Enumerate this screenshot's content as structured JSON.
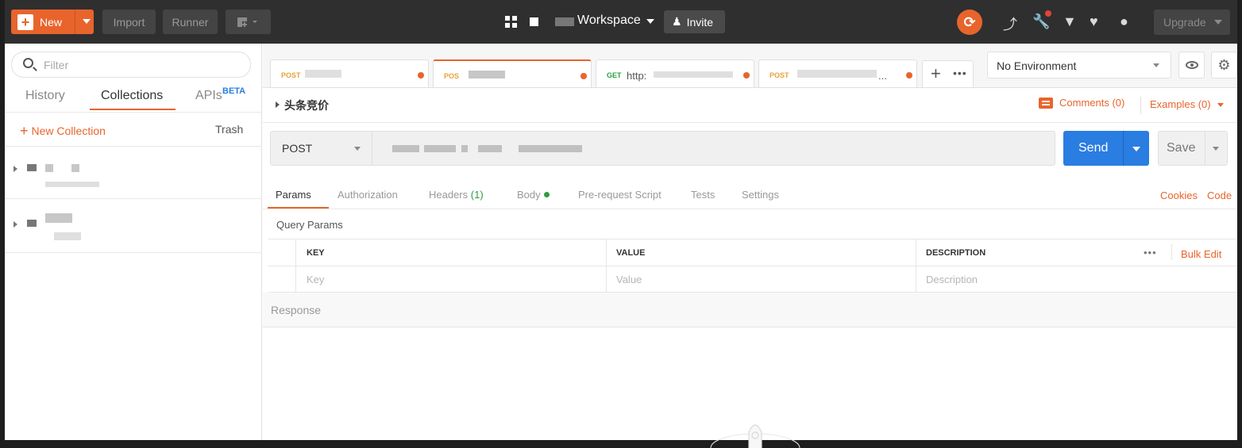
{
  "topbar": {
    "new_label": "New",
    "import_label": "Import",
    "runner_label": "Runner",
    "workspace_label": "Workspace",
    "invite_label": "Invite",
    "upgrade_label": "Upgrade"
  },
  "sidebar": {
    "filter_placeholder": "Filter",
    "tabs": [
      {
        "label": "History"
      },
      {
        "label": "Collections",
        "active": true
      },
      {
        "label": "APIs",
        "badge": "BETA"
      }
    ],
    "new_collection_label": "New Collection",
    "trash_label": "Trash"
  },
  "request_tabs": [
    {
      "method": "POST",
      "url": "",
      "unsaved": true
    },
    {
      "method": "POS",
      "url": "",
      "unsaved": true,
      "active": true
    },
    {
      "method": "GET",
      "url": "http:",
      "unsaved": true
    },
    {
      "method": "POST",
      "url": "...",
      "unsaved": true
    }
  ],
  "environment": {
    "selected": "No Environment"
  },
  "request": {
    "name": "头条竞价",
    "comments_label": "Comments (0)",
    "examples_label": "Examples (0)",
    "method": "POST",
    "send_label": "Send",
    "save_label": "Save"
  },
  "request_subtabs": {
    "params": "Params",
    "authorization": "Authorization",
    "headers": "Headers",
    "headers_count": "(1)",
    "body": "Body",
    "prerequest": "Pre-request Script",
    "tests": "Tests",
    "settings": "Settings",
    "cookies": "Cookies",
    "code": "Code"
  },
  "query_params": {
    "label": "Query Params",
    "columns": [
      "KEY",
      "VALUE",
      "DESCRIPTION"
    ],
    "key_placeholder": "Key",
    "value_placeholder": "Value",
    "description_placeholder": "Description",
    "more_label": "•••",
    "bulk_edit_label": "Bulk Edit"
  },
  "response": {
    "label": "Response"
  },
  "colors": {
    "accent": "#e8642c",
    "primary": "#2a7de1",
    "topbar": "#2f2f2f",
    "success": "#2f9c3f"
  }
}
